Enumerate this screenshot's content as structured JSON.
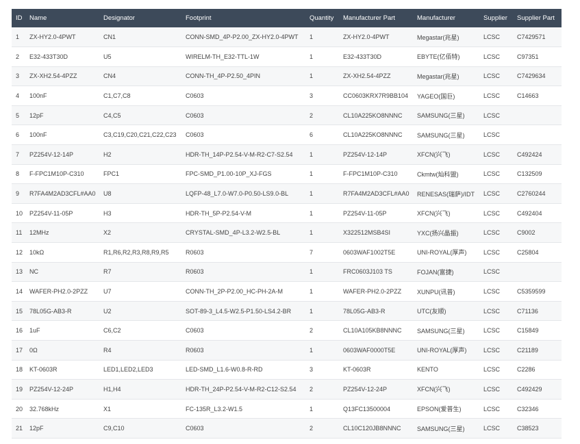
{
  "columns": [
    "ID",
    "Name",
    "Designator",
    "Footprint",
    "Quantity",
    "Manufacturer Part",
    "Manufacturer",
    "Supplier",
    "Supplier Part"
  ],
  "rows": [
    [
      "1",
      "ZX-HY2.0-4PWT",
      "CN1",
      "CONN-SMD_4P-P2.00_ZX-HY2.0-4PWT",
      "1",
      "ZX-HY2.0-4PWT",
      "Megastar(兆星)",
      "LCSC",
      "C7429571"
    ],
    [
      "2",
      "E32-433T30D",
      "U5",
      "WIRELM-TH_E32-TTL-1W",
      "1",
      "E32-433T30D",
      "EBYTE(亿佰特)",
      "LCSC",
      "C97351"
    ],
    [
      "3",
      "ZX-XH2.54-4PZZ",
      "CN4",
      "CONN-TH_4P-P2.50_4PIN",
      "1",
      "ZX-XH2.54-4PZZ",
      "Megastar(兆星)",
      "LCSC",
      "C7429634"
    ],
    [
      "4",
      "100nF",
      "C1,C7,C8",
      "C0603",
      "3",
      "CC0603KRX7R9BB104",
      "YAGEO(国巨)",
      "LCSC",
      "C14663"
    ],
    [
      "5",
      "12pF",
      "C4,C5",
      "C0603",
      "2",
      "CL10A225KO8NNNC",
      "SAMSUNG(三星)",
      "LCSC",
      ""
    ],
    [
      "6",
      "100nF",
      "C3,C19,C20,C21,C22,C23",
      "C0603",
      "6",
      "CL10A225KO8NNNC",
      "SAMSUNG(三星)",
      "LCSC",
      ""
    ],
    [
      "7",
      "PZ254V-12-14P",
      "H2",
      "HDR-TH_14P-P2.54-V-M-R2-C7-S2.54",
      "1",
      "PZ254V-12-14P",
      "XFCN(兴飞)",
      "LCSC",
      "C492424"
    ],
    [
      "8",
      "F-FPC1M10P-C310",
      "FPC1",
      "FPC-SMD_P1.00-10P_XJ-FGS",
      "1",
      "F-FPC1M10P-C310",
      "Ckmtw(灿科盟)",
      "LCSC",
      "C132509"
    ],
    [
      "9",
      "R7FA4M2AD3CFL#AA0",
      "U8",
      "LQFP-48_L7.0-W7.0-P0.50-LS9.0-BL",
      "1",
      "R7FA4M2AD3CFL#AA0",
      "RENESAS(瑞萨)/IDT",
      "LCSC",
      "C2760244"
    ],
    [
      "10",
      "PZ254V-11-05P",
      "H3",
      "HDR-TH_5P-P2.54-V-M",
      "1",
      "PZ254V-11-05P",
      "XFCN(兴飞)",
      "LCSC",
      "C492404"
    ],
    [
      "11",
      "12MHz",
      "X2",
      "CRYSTAL-SMD_4P-L3.2-W2.5-BL",
      "1",
      "X322512MSB4SI",
      "YXC(扬兴晶振)",
      "LCSC",
      "C9002"
    ],
    [
      "12",
      "10kΩ",
      "R1,R6,R2,R3,R8,R9,R5",
      "R0603",
      "7",
      "0603WAF1002T5E",
      "UNI-ROYAL(厚声)",
      "LCSC",
      "C25804"
    ],
    [
      "13",
      "NC",
      "R7",
      "R0603",
      "1",
      "FRC0603J103 TS",
      "FOJAN(富捷)",
      "LCSC",
      ""
    ],
    [
      "14",
      "WAFER-PH2.0-2PZZ",
      "U7",
      "CONN-TH_2P-P2.00_HC-PH-2A-M",
      "1",
      "WAFER-PH2.0-2PZZ",
      "XUNPU(讯普)",
      "LCSC",
      "C5359599"
    ],
    [
      "15",
      "78L05G-AB3-R",
      "U2",
      "SOT-89-3_L4.5-W2.5-P1.50-LS4.2-BR",
      "1",
      "78L05G-AB3-R",
      "UTC(友顺)",
      "LCSC",
      "C71136"
    ],
    [
      "16",
      "1uF",
      "C6,C2",
      "C0603",
      "2",
      "CL10A105KB8NNNC",
      "SAMSUNG(三星)",
      "LCSC",
      "C15849"
    ],
    [
      "17",
      "0Ω",
      "R4",
      "R0603",
      "1",
      "0603WAF0000T5E",
      "UNI-ROYAL(厚声)",
      "LCSC",
      "C21189"
    ],
    [
      "18",
      "KT-0603R",
      "LED1,LED2,LED3",
      "LED-SMD_L1.6-W0.8-R-RD",
      "3",
      "KT-0603R",
      "KENTO",
      "LCSC",
      "C2286"
    ],
    [
      "19",
      "PZ254V-12-24P",
      "H1,H4",
      "HDR-TH_24P-P2.54-V-M-R2-C12-S2.54",
      "2",
      "PZ254V-12-24P",
      "XFCN(兴飞)",
      "LCSC",
      "C492429"
    ],
    [
      "20",
      "32.768kHz",
      "X1",
      "FC-135R_L3.2-W1.5",
      "1",
      "Q13FC13500004",
      "EPSON(爱普生)",
      "LCSC",
      "C32346"
    ],
    [
      "21",
      "12pF",
      "C9,C10",
      "C0603",
      "2",
      "CL10C120JB8NNNC",
      "SAMSUNG(三星)",
      "LCSC",
      "C38523"
    ]
  ]
}
